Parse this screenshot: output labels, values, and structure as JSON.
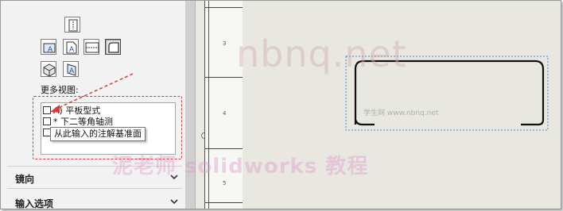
{
  "panel": {
    "more_views_label": "更多视图:",
    "view_list": [
      {
        "text": "A) 平板型式",
        "checked": false
      },
      {
        "text": "* 下二等角轴测",
        "checked": false
      },
      {
        "text": "",
        "checked": false
      }
    ],
    "tooltip": "从此输入的注解基准面",
    "sections": [
      {
        "title": "镜向",
        "icon": "chevron-down-icon"
      },
      {
        "title": "输入选项",
        "icon": "chevron-down-icon"
      }
    ]
  },
  "sheet": {
    "zone_letters": [
      "3",
      "4",
      "5"
    ]
  },
  "watermarks": {
    "big": "nbnq.net",
    "small": "学生网 www.nbnq.net",
    "bottom": "泥老师 solidworks 教程"
  },
  "colors": {
    "annotation_red": "#d63c3c",
    "selection_blue": "#3a8bd0",
    "canvas_bg": "#e8e8e1",
    "panel_bg": "#f2f2f2"
  },
  "icons": [
    "view-single-icon",
    "view-front-icon",
    "view-top-icon",
    "view-side-icon",
    "view-flat-icon",
    "view-isometric-icon",
    "view-annotation-icon"
  ]
}
